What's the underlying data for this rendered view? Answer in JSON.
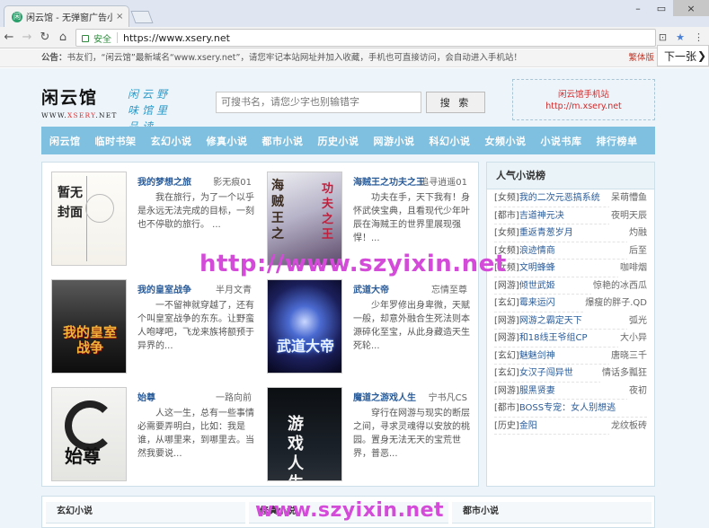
{
  "browser": {
    "tab_title": "闲云馆 - 无弹窗广告小说",
    "tab_favicon": "闲",
    "close_glyph": "×",
    "window_controls": [
      "–",
      "▭",
      "×"
    ],
    "secure_label": "安全",
    "url": "https://www.xsery.net",
    "icons": [
      "back-icon",
      "forward-icon",
      "reload-icon",
      "home-icon",
      "lock-icon",
      "translate-icon",
      "star-icon",
      "menu-icon"
    ]
  },
  "notice": {
    "label": "公告：",
    "text": "书友们，“闲云馆”最新域名“www.xsery.net”，请您牢记本站网址并加入收藏，手机也可直接访问，会自动进入手机站！",
    "switch": "繁体版"
  },
  "next_button": "下一张",
  "header": {
    "logo": "闲云馆",
    "logo_url_prefix": "WWW.",
    "logo_url_brand": "XSERY",
    "logo_url_suffix": ".NET",
    "slogan": "闲云野味馆里品读",
    "search_placeholder": "可搜书名，请您少字也别输错字",
    "search_button": "搜 索",
    "mobile_title": "闲云馆手机站",
    "mobile_url": "http://m.xsery.net"
  },
  "nav": [
    "闲云馆",
    "临时书架",
    "玄幻小说",
    "修真小说",
    "都市小说",
    "历史小说",
    "网游小说",
    "科幻小说",
    "女频小说",
    "小说书库",
    "排行榜单"
  ],
  "featured": [
    {
      "title": "我的梦想之旅",
      "author": "影无痕01",
      "desc": "我在旅行，为了一个以乎是永远无法完成的目标，一刻也不停歇的旅行。    ...",
      "cover_text": "暂无封面"
    },
    {
      "title": "海贼王之功夫之王",
      "author": "追寻逍遥01",
      "desc": "功夫在手，天下我有！身怀武侠宝典，且看现代少年叶辰在海贼王的世界里展现强悍！...",
      "cover_text": "海贼王之",
      "cover_sub": "功夫之王"
    },
    {
      "title": "我的皇室战争",
      "author": "半月文青",
      "desc": "一不留神就穿越了，还有个叫皇室战争的东东。让野蛮人咆哮吧，飞龙来族将额预于异界的...",
      "cover_text": "我的皇室战争"
    },
    {
      "title": "武道大帝",
      "author": "忘情至尊",
      "desc": "少年罗修出身卑微，天赋一般，却意外融合生死法则本源碎化至宝，从此身藏造天生死轮...",
      "cover_text": "武道大帝"
    },
    {
      "title": "始尊",
      "author": "一路向前",
      "desc": "人这一生，总有一些事情必需要弄明白，比如：我是谁，从哪里来，到哪里去。当然我要说...",
      "cover_text": "始尊"
    },
    {
      "title": "魔道之游戏人生",
      "author": "宁书凡CS",
      "desc": "穿行在网游与现实的断层之间，寻求灵魂得以安放的桃园。置身无法无天的宝荒世界，普恶...",
      "cover_text": "游戏人生"
    }
  ],
  "popular": {
    "title": "人气小说榜",
    "items": [
      {
        "cat": "[女频]",
        "book": "我的二次元恶搞系统",
        "author": "呆萌懵鱼"
      },
      {
        "cat": "[都市]",
        "book": "吉道神元决",
        "author": "夜明天辰"
      },
      {
        "cat": "[女频]",
        "book": "重返青葱岁月",
        "author": "灼融"
      },
      {
        "cat": "[女频]",
        "book": "浪迹情商",
        "author": "后至"
      },
      {
        "cat": "[女频]",
        "book": "文明蜂蜂",
        "author": "咖啡烟"
      },
      {
        "cat": "[网游]",
        "book": "倾世武姬",
        "author": "惊艳的冰西瓜"
      },
      {
        "cat": "[玄幻]",
        "book": "霉来运闪",
        "author": "爆瘦的胖子.QD"
      },
      {
        "cat": "[网游]",
        "book": "网游之霸定天下",
        "author": "弧光"
      },
      {
        "cat": "[网游]",
        "book": "和18线王爷组CP",
        "author": "大小异"
      },
      {
        "cat": "[玄幻]",
        "book": "魅魅剑神",
        "author": "唐晓三千"
      },
      {
        "cat": "[玄幻]",
        "book": "女汉子闯异世",
        "author": "情话多瓢狂"
      },
      {
        "cat": "[网游]",
        "book": "服黑贤妻",
        "author": "夜初"
      },
      {
        "cat": "[都市]",
        "book": "BOSS专宠：女人别想逃",
        "author": ""
      },
      {
        "cat": "[历史]",
        "book": "金阳",
        "author": "龙纹板砖"
      }
    ]
  },
  "bottom_sections": [
    "玄幻小说",
    "修真小说",
    "都市小说"
  ],
  "watermark": "http://www.szyixin.net",
  "watermark2": "www.szyixin.net",
  "colors": {
    "nav_bg": "#7fbfdf",
    "page_bg": "#edf5fb",
    "link": "#2a5c9a",
    "watermark": "#d44ad9",
    "slogan": "#2f9bc9"
  }
}
